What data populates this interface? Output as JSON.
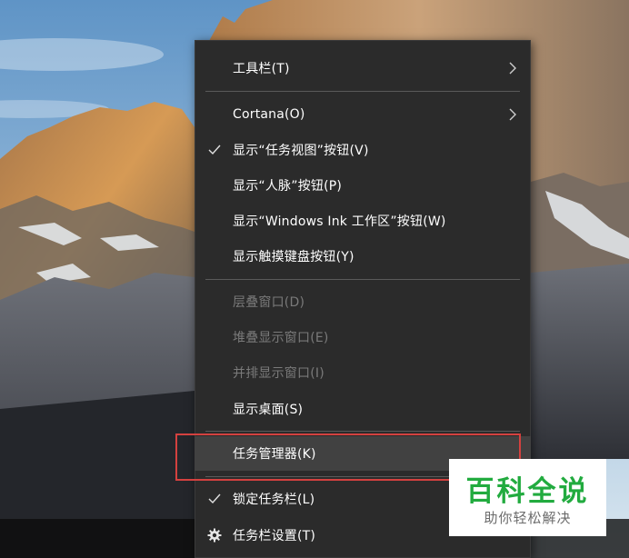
{
  "context_menu": {
    "items": [
      {
        "label": "工具栏(T)",
        "submenu": true,
        "checked": false,
        "enabled": true
      },
      {
        "label": "Cortana(O)",
        "submenu": true,
        "checked": false,
        "enabled": true
      },
      {
        "label": "显示“任务视图”按钮(V)",
        "checked": true,
        "enabled": true
      },
      {
        "label": "显示“人脉”按钮(P)",
        "checked": false,
        "enabled": true
      },
      {
        "label": "显示“Windows Ink 工作区”按钮(W)",
        "checked": false,
        "enabled": true
      },
      {
        "label": "显示触摸键盘按钮(Y)",
        "checked": false,
        "enabled": true
      },
      {
        "label": "层叠窗口(D)",
        "checked": false,
        "enabled": false
      },
      {
        "label": "堆叠显示窗口(E)",
        "checked": false,
        "enabled": false
      },
      {
        "label": "并排显示窗口(I)",
        "checked": false,
        "enabled": false
      },
      {
        "label": "显示桌面(S)",
        "checked": false,
        "enabled": true
      },
      {
        "label": "任务管理器(K)",
        "checked": false,
        "enabled": true,
        "highlighted": true
      },
      {
        "label": "锁定任务栏(L)",
        "checked": true,
        "enabled": true
      },
      {
        "label": "任务栏设置(T)",
        "icon": "gear-icon",
        "enabled": true
      }
    ]
  },
  "annotation": {
    "box_color": "#d4413f"
  },
  "watermark": {
    "title": "百科全说",
    "subtitle": "助你轻松解决",
    "title_color": "#22ab3f"
  },
  "colors": {
    "menu_bg": "#2b2b2b",
    "highlight_bg": "#414141",
    "disabled_text": "#7a7a7a"
  }
}
